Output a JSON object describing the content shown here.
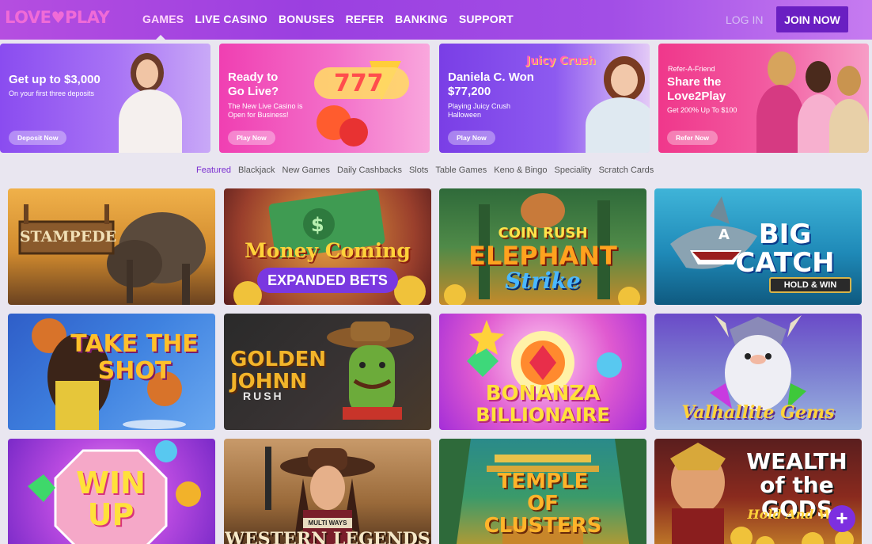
{
  "header": {
    "logo_left": "LOVE",
    "logo_right": "PLAY",
    "nav": [
      "GAMES",
      "LIVE CASINO",
      "BONUSES",
      "REFER",
      "BANKING",
      "SUPPORT"
    ],
    "login": "LOG IN",
    "join": "JOIN NOW"
  },
  "banners": [
    {
      "title": "Get up to $3,000",
      "sub": "On your first three deposits",
      "button": "Deposit Now"
    },
    {
      "title": "Ready to Go Live?",
      "sub": "The New Live Casino is Open for Business!",
      "button": "Play Now"
    },
    {
      "title": "Daniela C. Won $77,200",
      "sub": "Playing Juicy Crush Halloween",
      "button": "Play Now",
      "logo": "Juicy Crush"
    },
    {
      "title": "Share the Love2Play",
      "pre": "Refer-A-Friend",
      "sub": "Get 200% Up To $100",
      "button": "Refer Now"
    }
  ],
  "categories": [
    "Featured",
    "Blackjack",
    "New Games",
    "Daily Cashbacks",
    "Slots",
    "Table Games",
    "Keno & Bingo",
    "Speciality",
    "Scratch Cards"
  ],
  "games": [
    {
      "title": "STAMPEDE",
      "sub": ""
    },
    {
      "title": "Money Coming",
      "sub": "EXPANDED BETS"
    },
    {
      "title": "ELEPHANT",
      "pre": "COIN RUSH",
      "sub": "Strike"
    },
    {
      "title": "BIG CATCH",
      "pre": "A",
      "sub": "HOLD & WIN"
    },
    {
      "title": "TAKE THE SHOT",
      "sub": ""
    },
    {
      "title": "GOLDEN JOHNN",
      "sub": "RUSH"
    },
    {
      "title": "BONANZA",
      "sub": "BILLIONAIRE"
    },
    {
      "title": "Valhallite Gems",
      "sub": ""
    },
    {
      "title": "WIN UP",
      "sub": ""
    },
    {
      "title": "WESTERN LEGENDS",
      "pre": "MULTI WAYS",
      "sub": ""
    },
    {
      "title": "TEMPLE OF CLUSTERS",
      "sub": ""
    },
    {
      "title": "WEALTH of the GODS",
      "sub": "Hold And Win"
    }
  ],
  "fab": "+",
  "colors": {
    "accent": "#7b2fd0",
    "header": "#9b3fe0",
    "join": "#6a1fc2"
  }
}
